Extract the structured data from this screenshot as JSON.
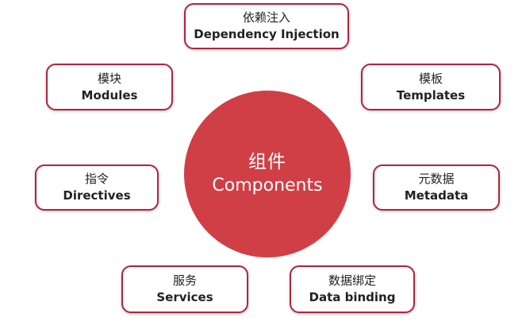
{
  "center": {
    "zh": "组件",
    "en": "Components",
    "color": "#d03f46"
  },
  "nodes": [
    {
      "zh": "依赖注入",
      "en": "Dependency Injection"
    },
    {
      "zh": "模块",
      "en": "Modules"
    },
    {
      "zh": "模板",
      "en": "Templates"
    },
    {
      "zh": "指令",
      "en": "Directives"
    },
    {
      "zh": "元数据",
      "en": "Metadata"
    },
    {
      "zh": "服务",
      "en": "Services"
    },
    {
      "zh": "数据绑定",
      "en": "Data binding"
    }
  ],
  "node_border_color": "#b2233b"
}
